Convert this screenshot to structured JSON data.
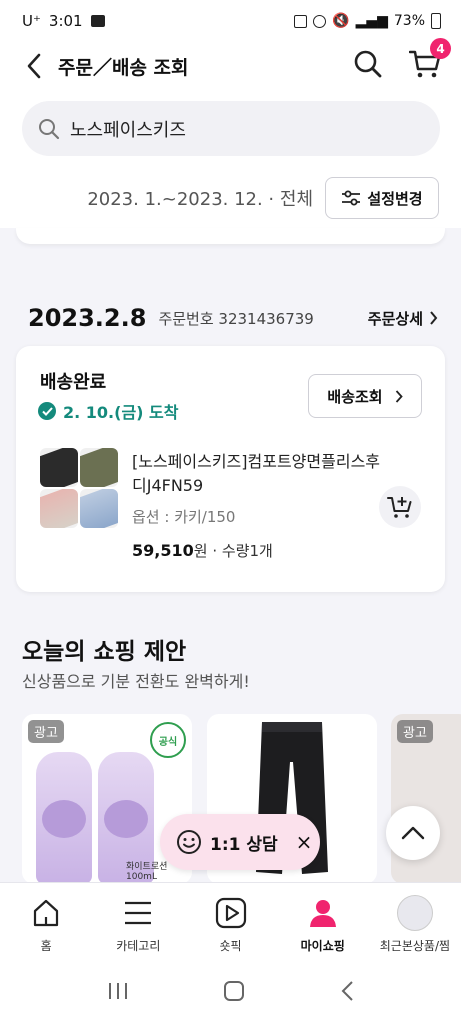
{
  "status_bar": {
    "carrier": "U⁺",
    "time": "3:01",
    "battery": "73%"
  },
  "app_bar": {
    "title": "주문／배송 조회",
    "cart_count": "4"
  },
  "search": {
    "value": "노스페이스키즈"
  },
  "filter": {
    "range_text": "2023. 1.~2023. 12. · 전체",
    "button_label": "설정변경"
  },
  "order": {
    "date": "2023.2.8",
    "order_number_text": "주문번호 3231436739",
    "detail_label": "주문상세",
    "status": "배송완료",
    "arrival_text": "2. 10.(금) 도착",
    "tracking_label": "배송조회",
    "product": {
      "name": "[노스페이스키즈]컴포트양면플리스후디J4FN59",
      "option": "옵션 : 카키/150",
      "price": "59,510",
      "price_suffix": "원 · 수량1개"
    }
  },
  "recommendation": {
    "title": "오늘의 쇼핑 제안",
    "subtitle": "신상품으로 기분 전환도 완벽하게!",
    "ad_label": "광고",
    "official_label": "공식",
    "promo_text": "화이트로션100mL"
  },
  "chat": {
    "label": "1:1 상담",
    "close": "×"
  },
  "bottom_nav": [
    {
      "label": "홈",
      "icon": "home-icon"
    },
    {
      "label": "카테고리",
      "icon": "menu-icon"
    },
    {
      "label": "숏픽",
      "icon": "play-icon"
    },
    {
      "label": "마이쇼핑",
      "icon": "person-icon"
    },
    {
      "label": "최근본상품/찜",
      "icon": "recent-products-icon"
    }
  ],
  "colors": {
    "accent_pink": "#f0246e",
    "delivered_green": "#148a7c",
    "chat_bg": "#fbe1ec"
  }
}
